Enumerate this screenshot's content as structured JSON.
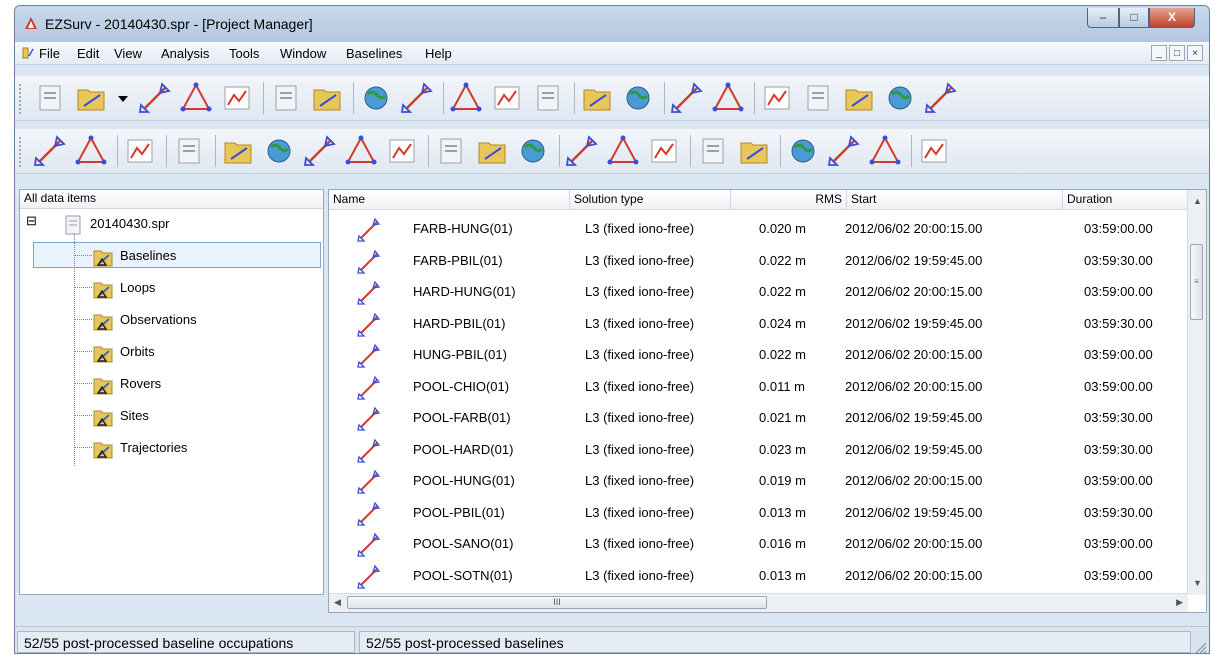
{
  "window": {
    "title": "EZSurv - 20140430.spr - [Project Manager]",
    "controls": {
      "minimize": "–",
      "maximize": "□",
      "close": "X"
    }
  },
  "menubar": {
    "items": [
      "File",
      "Edit",
      "View",
      "Analysis",
      "Tools",
      "Window",
      "Baselines",
      "Help"
    ],
    "mdi_controls": [
      "_",
      "□",
      "×"
    ]
  },
  "tree": {
    "header": "All data items",
    "root": {
      "label": "20140430.spr",
      "expander": "⊟"
    },
    "items": [
      {
        "label": "Baselines",
        "icon": "baselines-folder-icon"
      },
      {
        "label": "Loops",
        "icon": "loops-folder-icon"
      },
      {
        "label": "Observations",
        "icon": "observations-folder-icon"
      },
      {
        "label": "Orbits",
        "icon": "orbits-folder-icon"
      },
      {
        "label": "Rovers",
        "icon": "rovers-folder-icon"
      },
      {
        "label": "Sites",
        "icon": "sites-folder-icon"
      },
      {
        "label": "Trajectories",
        "icon": "trajectories-folder-icon"
      }
    ],
    "selected": "Baselines"
  },
  "list": {
    "columns": [
      "Name",
      "Solution type",
      "RMS",
      "Start",
      "Duration"
    ],
    "rows": [
      [
        "FARB-HUNG(01)",
        "L3 (fixed iono-free)",
        "0.020 m",
        "2012/06/02 20:00:15.00",
        "03:59:00.00"
      ],
      [
        "FARB-PBIL(01)",
        "L3 (fixed iono-free)",
        "0.022 m",
        "2012/06/02 19:59:45.00",
        "03:59:30.00"
      ],
      [
        "HARD-HUNG(01)",
        "L3 (fixed iono-free)",
        "0.022 m",
        "2012/06/02 20:00:15.00",
        "03:59:00.00"
      ],
      [
        "HARD-PBIL(01)",
        "L3 (fixed iono-free)",
        "0.024 m",
        "2012/06/02 19:59:45.00",
        "03:59:30.00"
      ],
      [
        "HUNG-PBIL(01)",
        "L3 (fixed iono-free)",
        "0.022 m",
        "2012/06/02 20:00:15.00",
        "03:59:00.00"
      ],
      [
        "POOL-CHIO(01)",
        "L3 (fixed iono-free)",
        "0.011 m",
        "2012/06/02 20:00:15.00",
        "03:59:00.00"
      ],
      [
        "POOL-FARB(01)",
        "L3 (fixed iono-free)",
        "0.021 m",
        "2012/06/02 19:59:45.00",
        "03:59:30.00"
      ],
      [
        "POOL-HARD(01)",
        "L3 (fixed iono-free)",
        "0.023 m",
        "2012/06/02 19:59:45.00",
        "03:59:30.00"
      ],
      [
        "POOL-HUNG(01)",
        "L3 (fixed iono-free)",
        "0.019 m",
        "2012/06/02 20:00:15.00",
        "03:59:00.00"
      ],
      [
        "POOL-PBIL(01)",
        "L3 (fixed iono-free)",
        "0.013 m",
        "2012/06/02 19:59:45.00",
        "03:59:30.00"
      ],
      [
        "POOL-SANO(01)",
        "L3 (fixed iono-free)",
        "0.016 m",
        "2012/06/02 20:00:15.00",
        "03:59:00.00"
      ],
      [
        "POOL-SOTN(01)",
        "L3 (fixed iono-free)",
        "0.013 m",
        "2012/06/02 20:00:15.00",
        "03:59:00.00"
      ]
    ],
    "hscroll_thumb": "III"
  },
  "status": {
    "left": "52/55 post-processed baseline occupations",
    "right": "52/55 post-processed baselines"
  },
  "toolbar1": [
    "new-project-icon",
    "open-project-icon",
    "open-dropdown-icon",
    "save-project-icon",
    "save-as-icon",
    "print-icon",
    "import-icon",
    "import-data-icon",
    "import-data-2-icon",
    "download-orbits-icon",
    "download-ephemeris-icon",
    "project-properties-icon",
    "map-view-icon",
    "processing-options-icon",
    "process-icon",
    "add-control-icon",
    "network-icon",
    "add-baseline-icon",
    "edit-baseline-icon",
    "delete-baseline-icon",
    "cursor-icon",
    "disabled-icon"
  ],
  "toolbar2": [
    "chart-icon",
    "table-icon",
    "timeline-icon",
    "satellite-icon",
    "baseline-analysis-icon",
    "residuals-icon",
    "baseline-zoom-icon",
    "baseline-residuals-icon",
    "loop-analysis-icon",
    "skyplot-icon",
    "signal-icon",
    "report-icon",
    "sky-view-icon",
    "network-adjust-icon",
    "network-map-icon",
    "control-point-icon",
    "fixed-point-icon",
    "free-adjust-icon",
    "north-icon",
    "adjust-all-icon",
    "pointer-icon"
  ],
  "colors": {
    "accent": "#d43a2c",
    "blue": "#3a4fd6",
    "folder": "#e7c65a"
  }
}
